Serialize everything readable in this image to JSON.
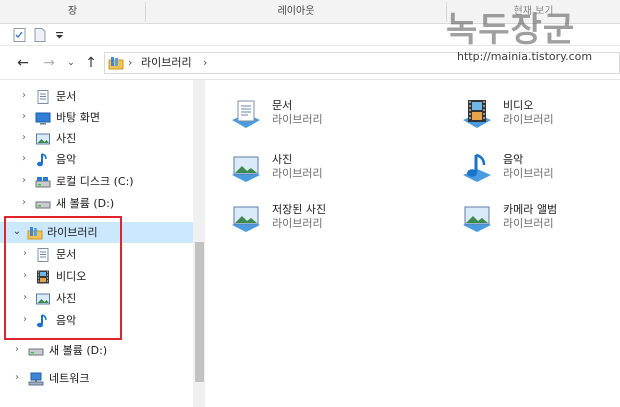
{
  "ribbon": {
    "tabs": [
      "장",
      "레이아웃",
      "현재 보기"
    ]
  },
  "address": {
    "path": [
      "라이브러리"
    ],
    "sep": "›"
  },
  "watermark": {
    "title": "녹두장군",
    "url": "http://mainia.tistory.com"
  },
  "nav": {
    "back": "←",
    "forward": "→",
    "up": "↑",
    "dropdown": "⌄"
  },
  "tree": {
    "items": [
      {
        "label": "문서",
        "icon": "document-icon"
      },
      {
        "label": "바탕 화면",
        "icon": "desktop-icon"
      },
      {
        "label": "사진",
        "icon": "pictures-icon"
      },
      {
        "label": "음악",
        "icon": "music-icon"
      },
      {
        "label": "로컬 디스크 (C:)",
        "icon": "local-disk-icon"
      },
      {
        "label": "새 볼륨 (D:)",
        "icon": "drive-icon"
      },
      {
        "label": "라이브러리",
        "icon": "library-icon"
      },
      {
        "label": "문서",
        "icon": "document-icon"
      },
      {
        "label": "비디오",
        "icon": "video-icon"
      },
      {
        "label": "사진",
        "icon": "pictures-icon"
      },
      {
        "label": "음악",
        "icon": "music-icon"
      },
      {
        "label": "새 볼륨 (D:)",
        "icon": "drive-icon"
      },
      {
        "label": "네트워크",
        "icon": "network-icon"
      }
    ],
    "chev_collapsed": "›",
    "chev_expanded": "⌄"
  },
  "libraries": [
    {
      "name": "문서",
      "sub": "라이브러리",
      "icon": "document-library-icon"
    },
    {
      "name": "비디오",
      "sub": "라이브러리",
      "icon": "video-library-icon"
    },
    {
      "name": "사진",
      "sub": "라이브러리",
      "icon": "pictures-library-icon"
    },
    {
      "name": "음악",
      "sub": "라이브러리",
      "icon": "music-library-icon"
    },
    {
      "name": "저장된 사진",
      "sub": "라이브러리",
      "icon": "saved-pictures-library-icon"
    },
    {
      "name": "카메라 앨범",
      "sub": "라이브러리",
      "icon": "camera-roll-library-icon"
    }
  ],
  "colors": {
    "selection": "#cce8ff",
    "highlight_border": "#e0242b",
    "music_blue": "#1a73c9"
  }
}
